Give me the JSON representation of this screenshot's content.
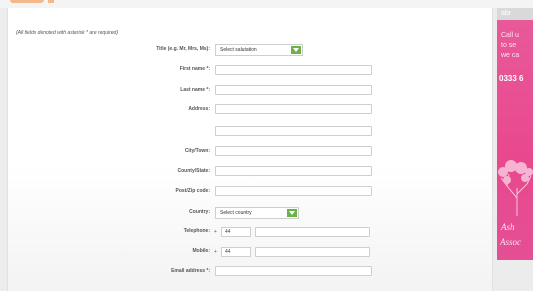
{
  "form": {
    "required_note": "(All fields denoted with asterisk * are required)",
    "title_label": "Title (e.g. Mr, Mrs, Ms):",
    "title_value": "Select salutation",
    "first_name_label": "First name *:",
    "last_name_label": "Last name *:",
    "address_label": "Address:",
    "city_label": "City/Town:",
    "county_label": "County/State:",
    "postcode_label": "Post/Zip code:",
    "country_label": "Country:",
    "country_value": "Select country",
    "telephone_label": "Telephone:",
    "telephone_plus": "+",
    "telephone_code": "44",
    "mobile_label": "Mobile:",
    "mobile_plus": "+",
    "mobile_code": "44",
    "email_label": "Email address *:"
  },
  "ad": {
    "top_text": "abr",
    "line1": "Call u",
    "line2": "to se",
    "line3": "we ca",
    "phone": "0333 6",
    "line4": "Ash",
    "line5": "Assoc",
    "accent_color": "#e9488d"
  },
  "colors": {
    "select_arrow": "#6bb24a"
  }
}
